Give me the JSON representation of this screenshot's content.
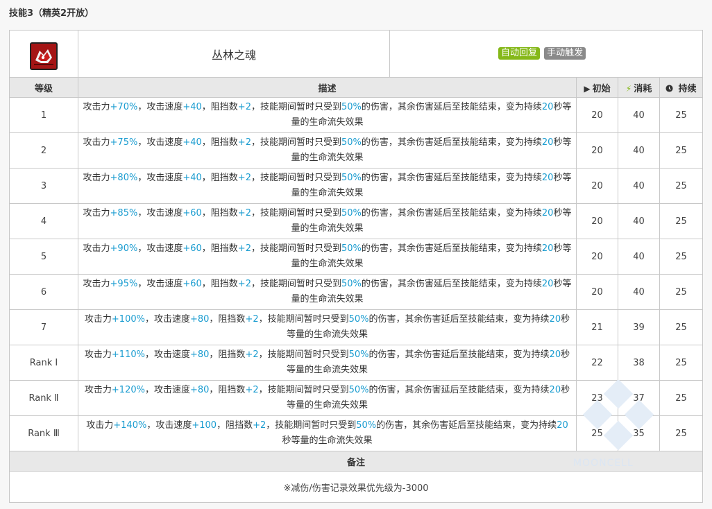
{
  "section_title": "技能3（精英2开放）",
  "skill": {
    "icon": "jungle-soul-skill-icon",
    "name": "丛林之魂",
    "tags": [
      {
        "label": "自动回复",
        "color": "#85b819"
      },
      {
        "label": "手动触发",
        "color": "#8a8a8a"
      }
    ]
  },
  "columns": {
    "level": "等级",
    "desc": "描述",
    "initial": "初始",
    "cost": "消耗",
    "duration": "持续",
    "initial_icon": "play-icon",
    "cost_icon": "lightning-icon",
    "duration_icon": "clock-icon"
  },
  "rows": [
    {
      "level": "1",
      "atk": "+70%",
      "aspd": "+40",
      "block": "+2",
      "pct": "50%",
      "secs": "20",
      "initial": "20",
      "cost": "40",
      "duration": "25"
    },
    {
      "level": "2",
      "atk": "+75%",
      "aspd": "+40",
      "block": "+2",
      "pct": "50%",
      "secs": "20",
      "initial": "20",
      "cost": "40",
      "duration": "25"
    },
    {
      "level": "3",
      "atk": "+80%",
      "aspd": "+40",
      "block": "+2",
      "pct": "50%",
      "secs": "20",
      "initial": "20",
      "cost": "40",
      "duration": "25"
    },
    {
      "level": "4",
      "atk": "+85%",
      "aspd": "+60",
      "block": "+2",
      "pct": "50%",
      "secs": "20",
      "initial": "20",
      "cost": "40",
      "duration": "25"
    },
    {
      "level": "5",
      "atk": "+90%",
      "aspd": "+60",
      "block": "+2",
      "pct": "50%",
      "secs": "20",
      "initial": "20",
      "cost": "40",
      "duration": "25"
    },
    {
      "level": "6",
      "atk": "+95%",
      "aspd": "+60",
      "block": "+2",
      "pct": "50%",
      "secs": "20",
      "initial": "20",
      "cost": "40",
      "duration": "25"
    },
    {
      "level": "7",
      "atk": "+100%",
      "aspd": "+80",
      "block": "+2",
      "pct": "50%",
      "secs": "20",
      "initial": "21",
      "cost": "39",
      "duration": "25"
    },
    {
      "level": "Rank Ⅰ",
      "atk": "+110%",
      "aspd": "+80",
      "block": "+2",
      "pct": "50%",
      "secs": "20",
      "initial": "22",
      "cost": "38",
      "duration": "25"
    },
    {
      "level": "Rank Ⅱ",
      "atk": "+120%",
      "aspd": "+80",
      "block": "+2",
      "pct": "50%",
      "secs": "20",
      "initial": "23",
      "cost": "37",
      "duration": "25"
    },
    {
      "level": "Rank Ⅲ",
      "atk": "+140%",
      "aspd": "+100",
      "block": "+2",
      "pct": "50%",
      "secs": "20",
      "initial": "25",
      "cost": "35",
      "duration": "25"
    }
  ],
  "desc_text": {
    "atk_label": "攻击力",
    "aspd_label": "，攻击速度",
    "block_label": "，阻挡数",
    "mid": "，技能期间暂时只受到",
    "after_pct": "的伤害，其余伤害延后至技能结束，变为持续",
    "tail": "秒等量的生命流失效果"
  },
  "remark": {
    "header": "备注",
    "text": "※减伤/伤害记录效果优先级为-3000"
  },
  "watermark_text": "MOONCELL"
}
